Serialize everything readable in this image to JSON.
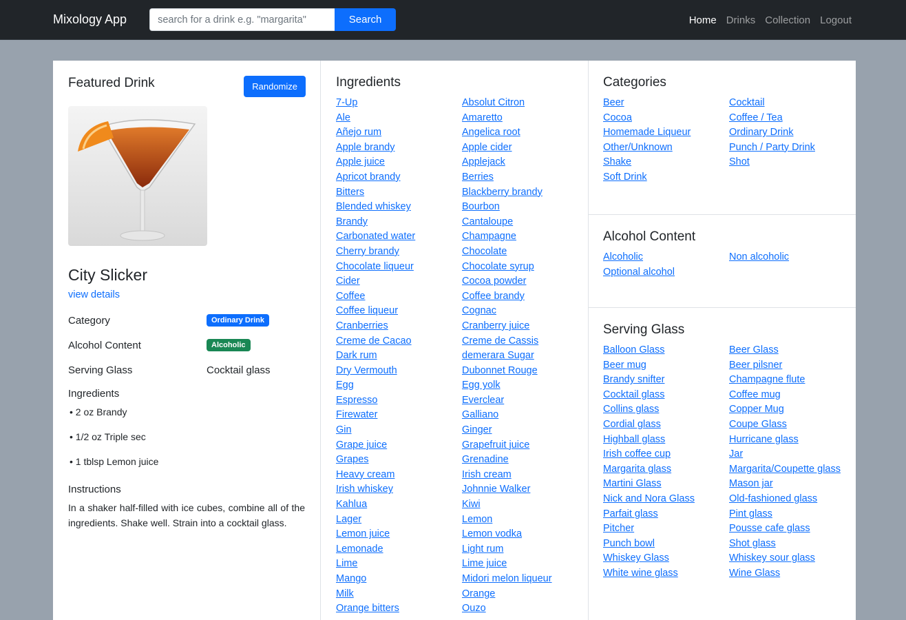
{
  "navbar": {
    "brand": "Mixology App",
    "search_placeholder": "search for a drink e.g. \"margarita\"",
    "search_button": "Search",
    "links": [
      "Home",
      "Drinks",
      "Collection",
      "Logout"
    ]
  },
  "featured": {
    "title": "Featured Drink",
    "randomize_label": "Randomize",
    "name": "City Slicker",
    "view_details": "view details",
    "category_label": "Category",
    "category_value": "Ordinary Drink",
    "alcohol_label": "Alcohol Content",
    "alcohol_value": "Alcoholic",
    "glass_label": "Serving Glass",
    "glass_value": "Cocktail glass",
    "ingredients_label": "Ingredients",
    "ingredients": [
      "• 2 oz Brandy",
      "• 1/2 oz Triple sec",
      "• 1 tblsp Lemon juice"
    ],
    "instructions_label": "Instructions",
    "instructions": "In a shaker half-filled with ice cubes, combine all of the ingredients. Shake well. Strain into a cocktail glass."
  },
  "ingredients": {
    "title": "Ingredients",
    "items": [
      "7-Up",
      "Absolut Citron",
      "Ale",
      "Amaretto",
      "Añejo rum",
      "Angelica root",
      "Apple brandy",
      "Apple cider",
      "Apple juice",
      "Applejack",
      "Apricot brandy",
      "Berries",
      "Bitters",
      "Blackberry brandy",
      "Blended whiskey",
      "Bourbon",
      "Brandy",
      "Cantaloupe",
      "Carbonated water",
      "Champagne",
      "Cherry brandy",
      "Chocolate",
      "Chocolate liqueur",
      "Chocolate syrup",
      "Cider",
      "Cocoa powder",
      "Coffee",
      "Coffee brandy",
      "Coffee liqueur",
      "Cognac",
      "Cranberries",
      "Cranberry juice",
      "Creme de Cacao",
      "Creme de Cassis",
      "Dark rum",
      "demerara Sugar",
      "Dry Vermouth",
      "Dubonnet Rouge",
      "Egg",
      "Egg yolk",
      "Espresso",
      "Everclear",
      "Firewater",
      "Galliano",
      "Gin",
      "Ginger",
      "Grape juice",
      "Grapefruit juice",
      "Grapes",
      "Grenadine",
      "Heavy cream",
      "Irish cream",
      "Irish whiskey",
      "Johnnie Walker",
      "Kahlua",
      "Kiwi",
      "Lager",
      "Lemon",
      "Lemon juice",
      "Lemon vodka",
      "Lemonade",
      "Light rum",
      "Lime",
      "Lime juice",
      "Mango",
      "Midori melon liqueur",
      "Milk",
      "Orange",
      "Orange bitters",
      "Ouzo"
    ]
  },
  "categories": {
    "title": "Categories",
    "items": [
      "Beer",
      "Cocktail",
      "Cocoa",
      "Coffee / Tea",
      "Homemade Liqueur",
      "Ordinary Drink",
      "Other/Unknown",
      "Punch / Party Drink",
      "Shake",
      "Shot",
      "Soft Drink"
    ]
  },
  "alcohol": {
    "title": "Alcohol Content",
    "items": [
      "Alcoholic",
      "Non alcoholic",
      "Optional alcohol"
    ]
  },
  "glasses": {
    "title": "Serving Glass",
    "items": [
      "Balloon Glass",
      "Beer Glass",
      "Beer mug",
      "Beer pilsner",
      "Brandy snifter",
      "Champagne flute",
      "Cocktail glass",
      "Coffee mug",
      "Collins glass",
      "Copper Mug",
      "Cordial glass",
      "Coupe Glass",
      "Highball glass",
      "Hurricane glass",
      "Irish coffee cup",
      "Jar",
      "Margarita glass",
      "Margarita/Coupette glass",
      "Martini Glass",
      "Mason jar",
      "Nick and Nora Glass",
      "Old-fashioned glass",
      "Parfait glass",
      "Pint glass",
      "Pitcher",
      "Pousse cafe glass",
      "Punch bowl",
      "Shot glass",
      "Whiskey Glass",
      "Whiskey sour glass",
      "White wine glass",
      "Wine Glass"
    ]
  }
}
